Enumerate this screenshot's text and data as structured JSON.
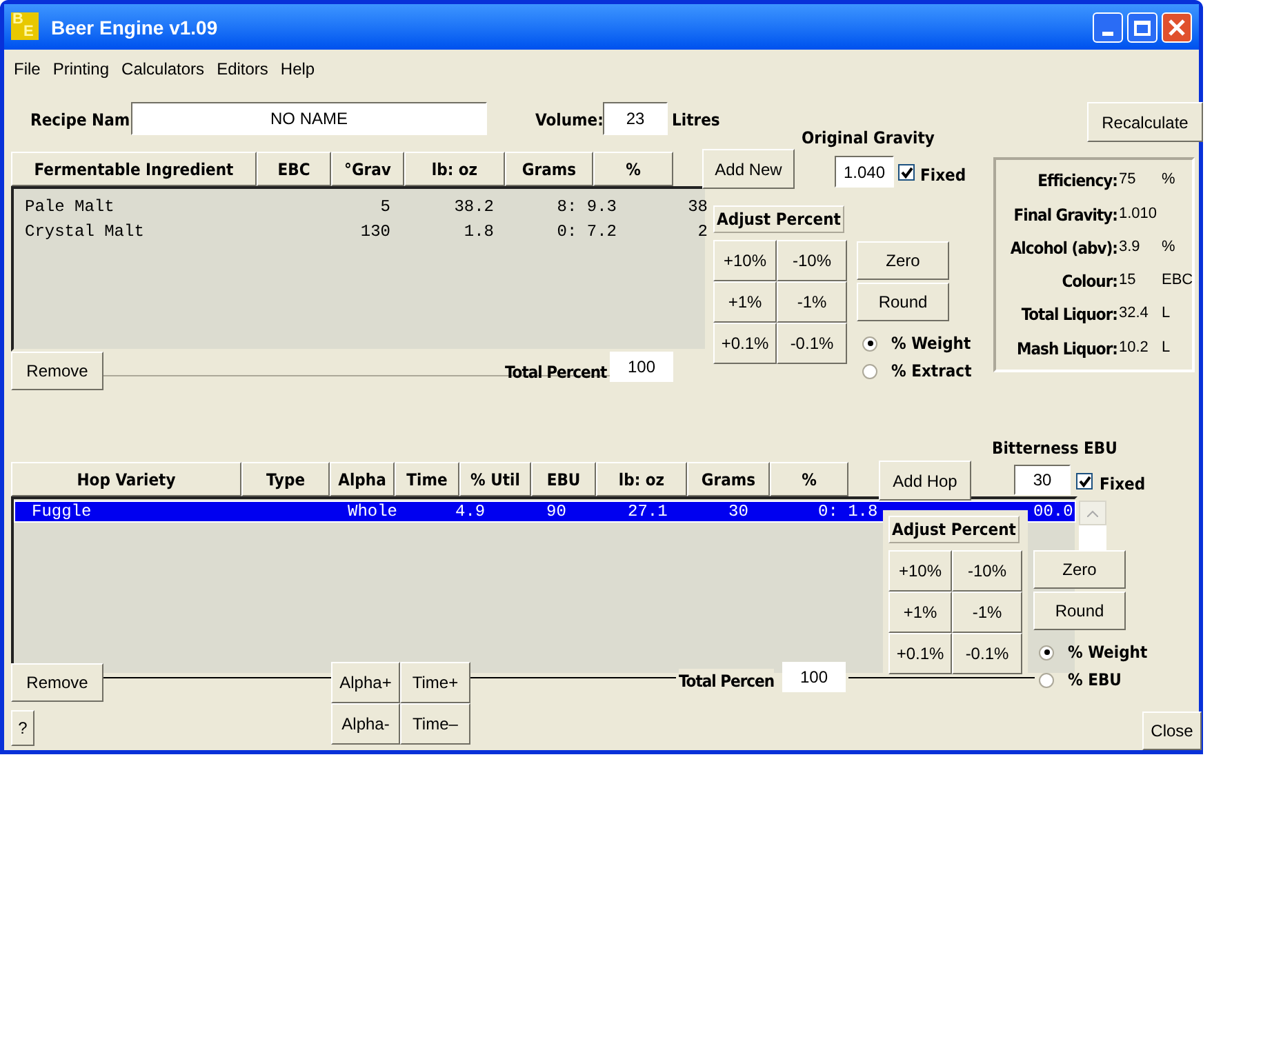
{
  "window": {
    "title": "Beer Engine v1.09",
    "icon_letters": [
      "B",
      "E"
    ]
  },
  "menu": [
    "File",
    "Printing",
    "Calculators",
    "Editors",
    "Help"
  ],
  "recipe": {
    "label": "Recipe Nam",
    "name": "NO NAME",
    "volume_label": "Volume:",
    "volume": "23",
    "volume_unit": "Litres"
  },
  "recalculate_button": "Recalculate",
  "original_gravity": {
    "label": "Original Gravity",
    "value": "1.040",
    "fixed_label": "Fixed",
    "fixed": true
  },
  "fermentables": {
    "columns": [
      "Fermentable Ingredient",
      "EBC",
      "°Grav",
      "lb: oz",
      "Grams",
      "%"
    ],
    "rows": [
      {
        "cells": [
          "Pale Malt",
          "",
          "5",
          "38.2",
          "8: 9.3",
          "38"
        ]
      },
      {
        "cells": [
          "Crystal Malt",
          "",
          "130",
          "1.8",
          "0: 7.2",
          "2"
        ]
      }
    ],
    "add_button": "Add New",
    "remove_button": "Remove",
    "total_label": "Total Percent",
    "total": "100",
    "adjust": {
      "title": "Adjust Percent",
      "steps": [
        "+10%",
        "-10%",
        "+1%",
        "-1%",
        "+0.1%",
        "-0.1%"
      ],
      "zero": "Zero",
      "round": "Round",
      "modes": [
        {
          "label": "% Weight",
          "selected": true
        },
        {
          "label": "% Extract",
          "selected": false
        }
      ]
    }
  },
  "stats": [
    {
      "label": "Efficiency:",
      "value": "75",
      "unit": "%"
    },
    {
      "label": "Final Gravity:",
      "value": "1.010"
    },
    {
      "label": "Alcohol (abv):",
      "value": "3.9",
      "unit": "%"
    },
    {
      "label": "Colour:",
      "value": "15",
      "unit": "EBC"
    },
    {
      "label": "Total Liquor:",
      "value": "32.4",
      "unit": "L"
    },
    {
      "label": "Mash Liquor:",
      "value": "10.2",
      "unit": "L"
    }
  ],
  "bitterness": {
    "label": "Bitterness EBU",
    "value": "30",
    "fixed_label": "Fixed",
    "fixed": true
  },
  "hops": {
    "columns": [
      "Hop Variety",
      "Type",
      "Alpha",
      "Time",
      "% Util",
      "EBU",
      "lb: oz",
      "Grams",
      "%"
    ],
    "rows": [
      {
        "cells": [
          "Fuggle",
          "",
          "Whole",
          "",
          "4.9",
          "90",
          "27.1",
          "30",
          "0: 1.8",
          "00.0"
        ],
        "selected": true
      }
    ],
    "add_button": "Add Hop",
    "remove_button": "Remove",
    "alpha_plus": "Alpha+",
    "time_plus": "Time+",
    "alpha_minus": "Alpha-",
    "time_minus": "Time–",
    "total_label": "Total Percen",
    "total": "100",
    "adjust": {
      "title": "Adjust Percent",
      "steps": [
        "+10%",
        "-10%",
        "+1%",
        "-1%",
        "+0.1%",
        "-0.1%"
      ],
      "zero": "Zero",
      "round": "Round",
      "modes": [
        {
          "label": "% Weight",
          "selected": true
        },
        {
          "label": "% EBU",
          "selected": false
        }
      ]
    }
  },
  "help_button": "?",
  "close_button": "Close"
}
